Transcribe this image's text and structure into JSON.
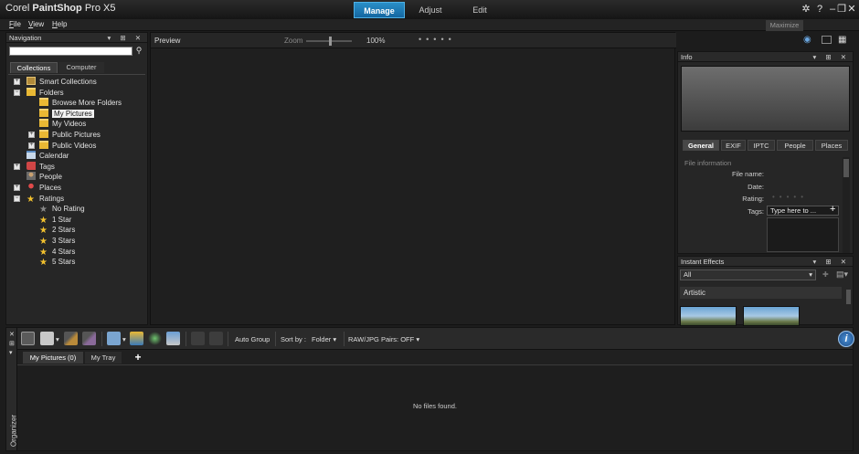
{
  "app": {
    "brand": "Corel",
    "product": "PaintShop",
    "edition": "Pro X5"
  },
  "modes": [
    {
      "label": "Manage",
      "active": true
    },
    {
      "label": "Adjust",
      "active": false
    },
    {
      "label": "Edit",
      "active": false
    }
  ],
  "window_controls": {
    "help": "?",
    "minimize": "–",
    "restore": "❐",
    "close": "✕"
  },
  "menu": [
    {
      "key": "F",
      "rest": "ile"
    },
    {
      "key": "V",
      "rest": "iew"
    },
    {
      "key": "H",
      "rest": "elp"
    }
  ],
  "maximize_label": "Maximize",
  "navigation": {
    "title": "Navigation",
    "search_value": "",
    "tabs": [
      "Collections",
      "Computer"
    ],
    "tree": [
      {
        "label": "Smart Collections",
        "depth": 0,
        "expander": "+",
        "icon": "smart-collections-icon",
        "selected": false
      },
      {
        "label": "Folders",
        "depth": 0,
        "expander": "−",
        "icon": "folder-icon",
        "selected": false
      },
      {
        "label": "Browse More Folders",
        "depth": 1,
        "expander": "",
        "icon": "folder-icon",
        "selected": false
      },
      {
        "label": "My Pictures",
        "depth": 1,
        "expander": "",
        "icon": "folder-icon",
        "selected": true
      },
      {
        "label": "My Videos",
        "depth": 1,
        "expander": "",
        "icon": "folder-icon",
        "selected": false
      },
      {
        "label": "Public Pictures",
        "depth": 1,
        "expander": "+",
        "icon": "folder-icon",
        "selected": false
      },
      {
        "label": "Public Videos",
        "depth": 1,
        "expander": "+",
        "icon": "folder-icon",
        "selected": false
      },
      {
        "label": "Calendar",
        "depth": 0,
        "expander": "",
        "icon": "calendar-icon",
        "selected": false
      },
      {
        "label": "Tags",
        "depth": 0,
        "expander": "+",
        "icon": "tag-icon",
        "selected": false
      },
      {
        "label": "People",
        "depth": 0,
        "expander": "",
        "icon": "people-icon",
        "selected": false
      },
      {
        "label": "Places",
        "depth": 0,
        "expander": "+",
        "icon": "map-pin-icon",
        "selected": false
      },
      {
        "label": "Ratings",
        "depth": 0,
        "expander": "−",
        "icon": "star-icon",
        "selected": false
      },
      {
        "label": "No Rating",
        "depth": 1,
        "expander": "",
        "icon": "grey-star-icon",
        "selected": false
      },
      {
        "label": "1 Star",
        "depth": 1,
        "expander": "",
        "icon": "star-icon",
        "selected": false
      },
      {
        "label": "2 Stars",
        "depth": 1,
        "expander": "",
        "icon": "star-icon",
        "selected": false
      },
      {
        "label": "3 Stars",
        "depth": 1,
        "expander": "",
        "icon": "star-icon",
        "selected": false
      },
      {
        "label": "4 Stars",
        "depth": 1,
        "expander": "",
        "icon": "star-icon",
        "selected": false
      },
      {
        "label": "5 Stars",
        "depth": 1,
        "expander": "",
        "icon": "star-icon",
        "selected": false
      }
    ]
  },
  "preview": {
    "title": "Preview",
    "zoom_label": "Zoom",
    "zoom_value": "100%",
    "zoom_level": 0.5
  },
  "info": {
    "title": "Info",
    "tabs": [
      {
        "label": "General",
        "active": true
      },
      {
        "label": "EXIF",
        "active": false
      },
      {
        "label": "IPTC",
        "active": false
      },
      {
        "label": "People",
        "active": false
      },
      {
        "label": "Places",
        "active": false
      }
    ],
    "section": "File information",
    "fields": [
      {
        "label": "File name:"
      },
      {
        "label": "Date:"
      },
      {
        "label": "Rating:"
      },
      {
        "label": "Tags:"
      }
    ],
    "tags_placeholder": "Type here to ...",
    "rating_value": 0
  },
  "instant_effects": {
    "title": "Instant Effects",
    "filter_value": "All",
    "category": "Artistic"
  },
  "organizer": {
    "side_label": "Organizer",
    "toolbar": {
      "auto_group": "Auto Group",
      "sort_by_label": "Sort by :",
      "sort_value": "Folder",
      "raw_pairs": "RAW/JPG Pairs: OFF",
      "info_button": "i"
    },
    "tabs": [
      "My Pictures (0)",
      "My Tray"
    ],
    "add_tab": "+",
    "empty_message": "No files found."
  },
  "colors": {
    "accent": "#1e7fc0",
    "folder": "#e9b834",
    "star": "#f2c12e"
  }
}
